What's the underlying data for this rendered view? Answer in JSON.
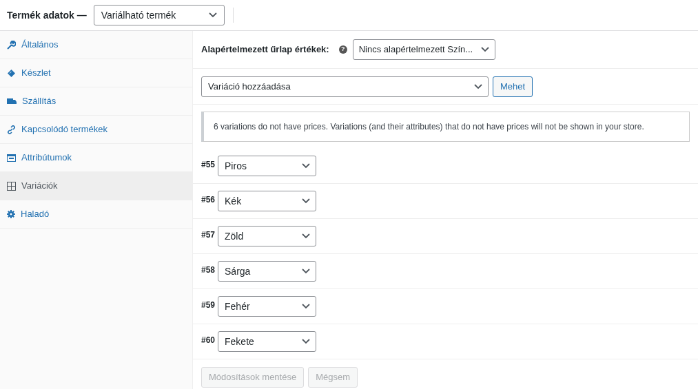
{
  "header": {
    "label": "Termék adatok —",
    "product_type": "Variálható termék"
  },
  "sidebar": {
    "items": [
      {
        "label": "Általános",
        "selected": false
      },
      {
        "label": "Készlet",
        "selected": false
      },
      {
        "label": "Szállítás",
        "selected": false
      },
      {
        "label": "Kapcsolódó termékek",
        "selected": false
      },
      {
        "label": "Attribútumok",
        "selected": false
      },
      {
        "label": "Variációk",
        "selected": true
      },
      {
        "label": "Haladó",
        "selected": false
      }
    ]
  },
  "defaults": {
    "label": "Alapértelmezett űrlap értékek:",
    "help": "?",
    "value": "Nincs alapértelmezett Szín..."
  },
  "bulk": {
    "value": "Variáció hozzáadása",
    "button": {
      "label": "Mehet",
      "disabled": false
    }
  },
  "notice": "6 variations do not have prices. Variations (and their attributes) that do not have prices will not be shown in your store.",
  "variations": [
    {
      "id": "#55",
      "value": "Piros"
    },
    {
      "id": "#56",
      "value": "Kék"
    },
    {
      "id": "#57",
      "value": "Zöld"
    },
    {
      "id": "#58",
      "value": "Sárga"
    },
    {
      "id": "#59",
      "value": "Fehér"
    },
    {
      "id": "#60",
      "value": "Fekete"
    }
  ],
  "buttons": [
    {
      "label": "Módosítások mentése",
      "disabled": true
    },
    {
      "label": "Mégsem",
      "disabled": true
    }
  ]
}
